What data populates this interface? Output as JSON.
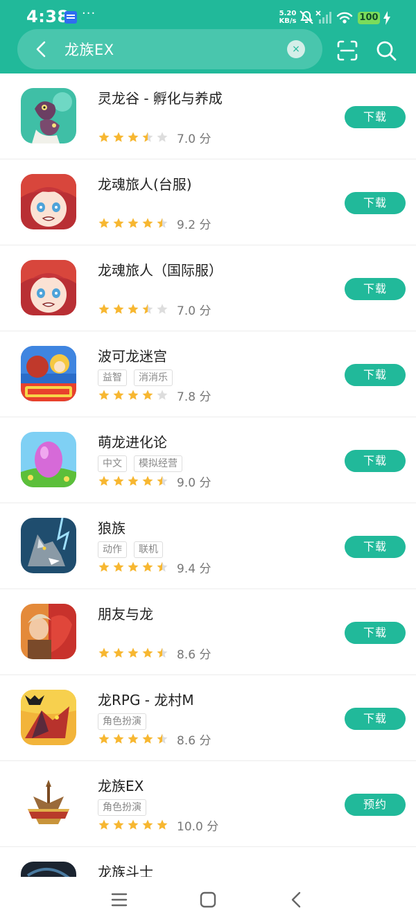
{
  "status": {
    "time": "4:38",
    "more": "···",
    "net_speed_value": "5.20",
    "net_speed_unit": "KB/s",
    "battery": "100"
  },
  "search": {
    "query": "龙族EX",
    "clear_glyph": "×"
  },
  "icons": {
    "back": "chevron-left-icon",
    "clear": "close-icon",
    "scan": "scan-icon",
    "search": "search-icon"
  },
  "colors": {
    "brand": "#21b99a",
    "star_filled": "#f7b731",
    "star_empty": "#dddddd"
  },
  "apps": [
    {
      "name": "灵龙谷 - 孵化与养成",
      "tags": [],
      "stars": 3.5,
      "score": "7.0 分",
      "action": "下载"
    },
    {
      "name": "龙魂旅人(台服)",
      "tags": [],
      "stars": 4.5,
      "score": "9.2 分",
      "action": "下载"
    },
    {
      "name": "龙魂旅人（国际服）",
      "tags": [],
      "stars": 3.5,
      "score": "7.0 分",
      "action": "下载"
    },
    {
      "name": "波可龙迷宫",
      "tags": [
        "益智",
        "消消乐"
      ],
      "stars": 4,
      "score": "7.8 分",
      "action": "下载"
    },
    {
      "name": "萌龙进化论",
      "tags": [
        "中文",
        "模拟经营"
      ],
      "stars": 4.5,
      "score": "9.0 分",
      "action": "下载"
    },
    {
      "name": "狼族",
      "tags": [
        "动作",
        "联机"
      ],
      "stars": 4.5,
      "score": "9.4 分",
      "action": "下载"
    },
    {
      "name": "朋友与龙",
      "tags": [],
      "stars": 4.5,
      "score": "8.6 分",
      "action": "下载"
    },
    {
      "name": "龙RPG - 龙村M",
      "tags": [
        "角色扮演"
      ],
      "stars": 4.5,
      "score": "8.6 分",
      "action": "下载"
    },
    {
      "name": "龙族EX",
      "tags": [
        "角色扮演"
      ],
      "stars": 5,
      "score": "10.0 分",
      "action": "预约"
    },
    {
      "name": "龙族斗士",
      "tags": [],
      "stars": 0,
      "score": "",
      "action": ""
    }
  ],
  "navbar": {
    "menu": "menu-icon",
    "home": "home-icon",
    "back": "back-icon"
  }
}
